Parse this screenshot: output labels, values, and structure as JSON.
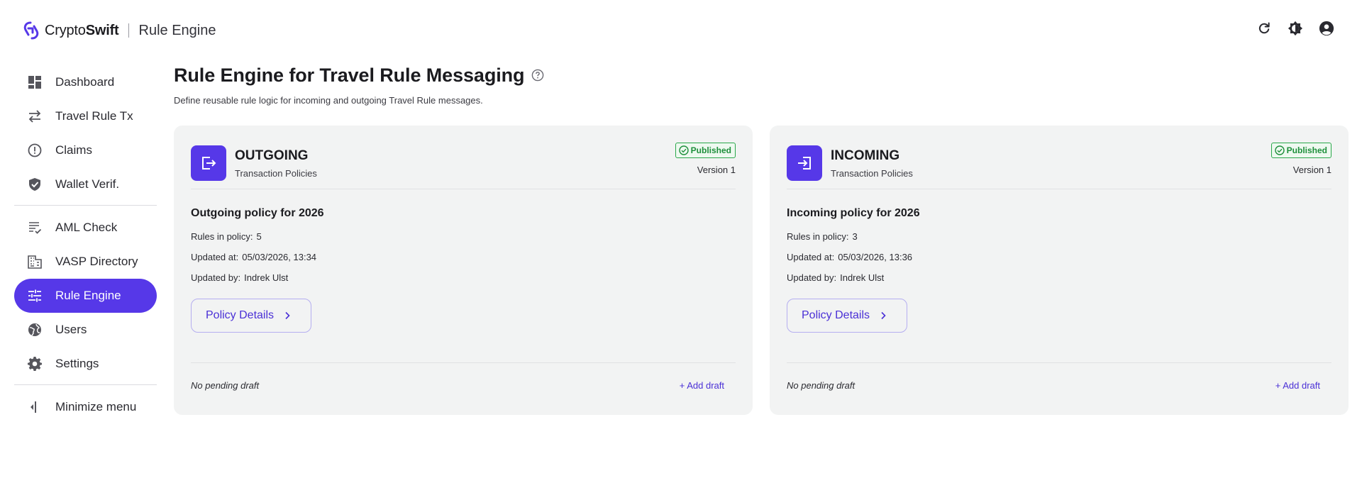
{
  "header": {
    "brand_prefix": "Crypto",
    "brand_suffix": "Swift",
    "section": "Rule Engine",
    "icons": [
      "refresh-icon",
      "theme-icon",
      "account-icon"
    ]
  },
  "sidebar": {
    "items": [
      {
        "label": "Dashboard",
        "icon": "dashboard-icon"
      },
      {
        "label": "Travel Rule Tx",
        "icon": "swap-icon"
      },
      {
        "label": "Claims",
        "icon": "alert-circle-icon"
      },
      {
        "label": "Wallet Verif.",
        "icon": "shield-check-icon"
      },
      {
        "label": "AML Check",
        "icon": "list-check-icon"
      },
      {
        "label": "VASP Directory",
        "icon": "building-icon"
      },
      {
        "label": "Rule Engine",
        "icon": "sliders-icon",
        "active": true
      },
      {
        "label": "Users",
        "icon": "globe-icon"
      },
      {
        "label": "Settings",
        "icon": "gear-icon"
      }
    ],
    "minimize_label": "Minimize menu"
  },
  "main": {
    "title": "Rule Engine for Travel Rule Messaging",
    "subtitle": "Define reusable rule logic for incoming and outgoing Travel Rule messages."
  },
  "cards": [
    {
      "direction": "OUTGOING",
      "subtitle": "Transaction Policies",
      "status": "Published",
      "version": "Version 1",
      "policy_name": "Outgoing policy for 2026",
      "rules_label": "Rules in policy:",
      "rules_count": "5",
      "updated_at_label": "Updated at:",
      "updated_at": "05/03/2026, 13:34",
      "updated_by_label": "Updated by:",
      "updated_by": "Indrek Ulst",
      "details_label": "Policy Details",
      "draft_status": "No pending draft",
      "add_draft_label": "+ Add draft"
    },
    {
      "direction": "INCOMING",
      "subtitle": "Transaction Policies",
      "status": "Published",
      "version": "Version 1",
      "policy_name": "Incoming policy for 2026",
      "rules_label": "Rules in policy:",
      "rules_count": "3",
      "updated_at_label": "Updated at:",
      "updated_at": "05/03/2026, 13:36",
      "updated_by_label": "Updated by:",
      "updated_by": "Indrek Ulst",
      "details_label": "Policy Details",
      "draft_status": "No pending draft",
      "add_draft_label": "+ Add draft"
    }
  ],
  "colors": {
    "accent": "#5638e8",
    "published_green": "#1e8f3b",
    "card_bg": "#f2f3f3"
  }
}
